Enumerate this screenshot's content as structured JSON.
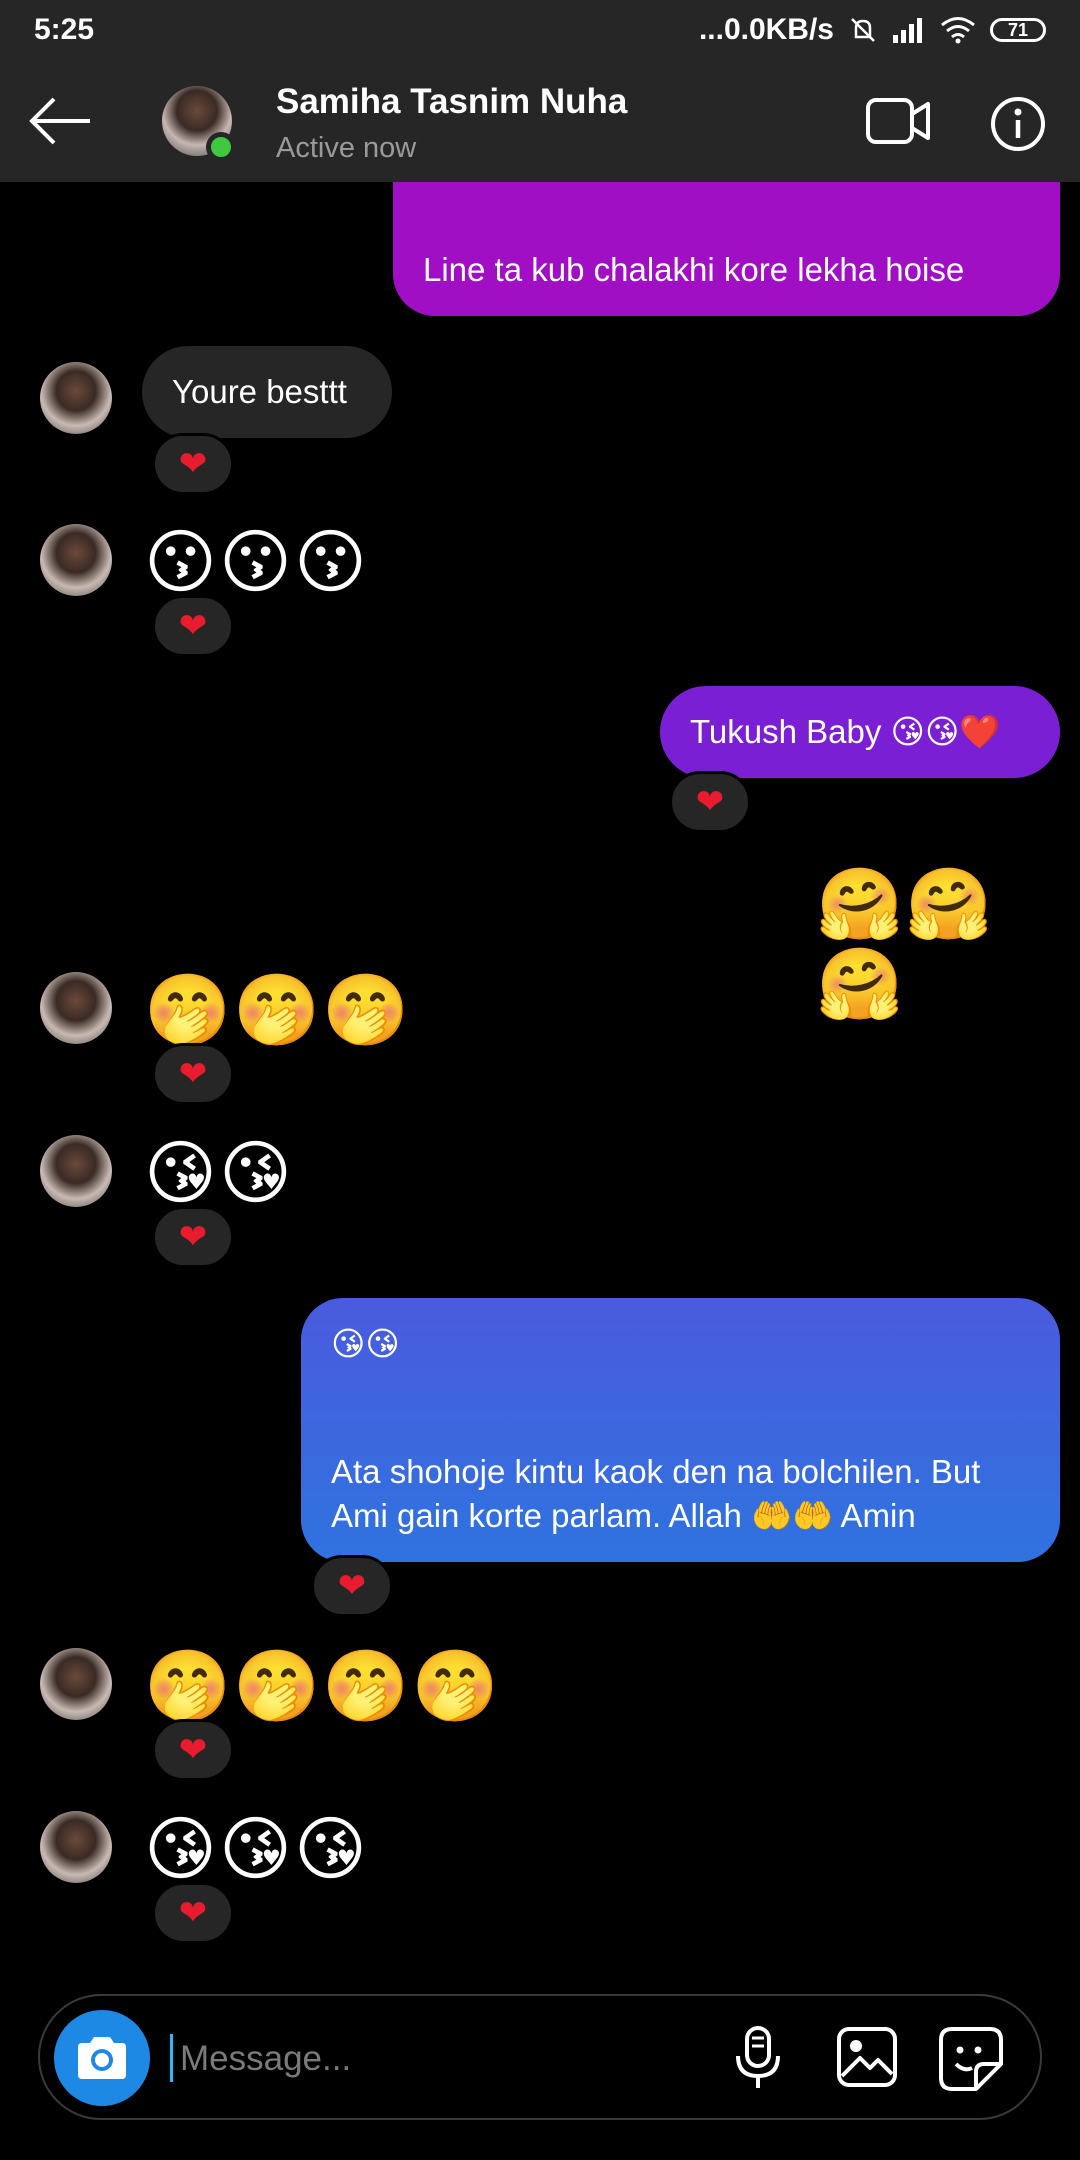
{
  "status_bar": {
    "time": "5:25",
    "network": "...0.0KB/s",
    "battery": "71"
  },
  "header": {
    "name": "Samiha Tasnim Nuha",
    "status": "Active now"
  },
  "messages": {
    "m1": "Line ta kub chalakhi kore lekha hoise",
    "m2": "Youre besttt",
    "m3": "😗😗😗",
    "m4": "Tukush Baby 😘😘❤️",
    "m5": "🤗🤗🤗",
    "m6": "🤭🤭🤭",
    "m7": "😘😘",
    "m8_line1": "😘😘",
    "m8_line2": "Ata shohoje kintu kaok den na bolchilen. But",
    "m8_line3": "Ami gain korte parlam. Allah 🤲🤲 Amin",
    "m9": "🤭🤭🤭🤭",
    "m10": "😘😘😘"
  },
  "reaction": "❤",
  "composer": {
    "placeholder": "Message..."
  },
  "colors": {
    "accent": "#a10fc4",
    "blue_bubble": "#3b66de",
    "camera": "#1e88e5",
    "online": "#3ec93e"
  }
}
